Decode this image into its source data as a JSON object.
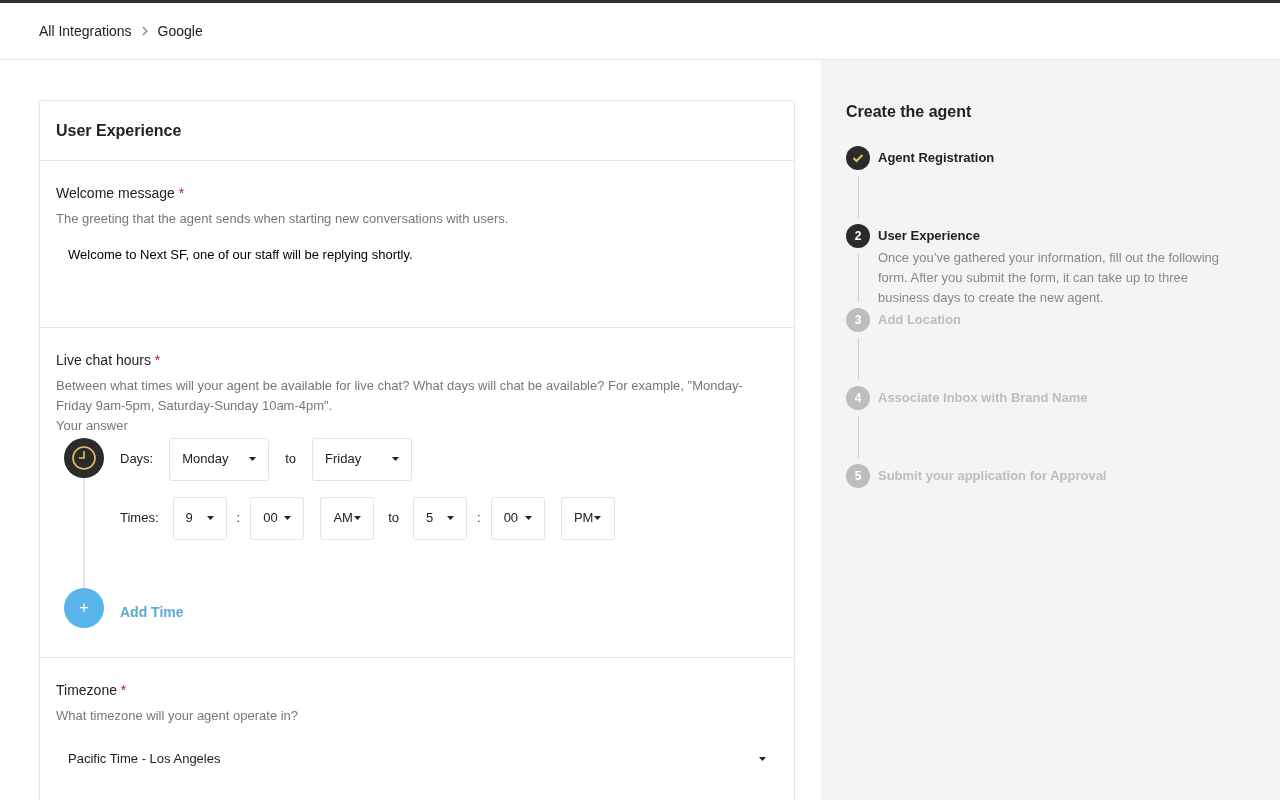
{
  "breadcrumb": [
    {
      "label": "All Integrations"
    },
    {
      "label": "Google"
    }
  ],
  "card": {
    "title": "User Experience",
    "welcome": {
      "label": "Welcome message",
      "required_mark": "*",
      "help": "The greeting that the agent sends when starting new conversations with users.",
      "value": "Welcome to Next SF, one of our staff will be replying shortly."
    },
    "hours": {
      "label": "Live chat hours",
      "required_mark": "*",
      "help": "Between what times will your agent be available for live chat? What days will chat be available? For example, \"Monday-Friday 9am-5pm, Saturday-Sunday 10am-4pm\".",
      "answer_label": "Your answer",
      "days_label": "Days:",
      "day_from": "Monday",
      "days_to": "to",
      "day_to": "Friday",
      "times_label": "Times:",
      "start": {
        "hour": "9",
        "sep": ":",
        "minute": "00",
        "period": "AM"
      },
      "times_to": "to",
      "end": {
        "hour": "5",
        "sep": ":",
        "minute": "00",
        "period": "PM"
      },
      "add_time": {
        "icon": "+",
        "label": "Add Time"
      }
    },
    "timezone": {
      "label": "Timezone",
      "required_mark": "*",
      "help": "What timezone will your agent operate in?",
      "value": "Pacific Time - Los Angeles"
    }
  },
  "steps_title": "Create the agent",
  "steps": [
    {
      "kind": "done",
      "title": "Agent Registration"
    },
    {
      "kind": "current",
      "number": "2",
      "title": "User Experience",
      "text": "Once you’ve gathered your information, fill out the following form. After you submit the form, it can take up to three business days to create the new agent."
    },
    {
      "kind": "pending",
      "number": "3",
      "title": "Add Location"
    },
    {
      "kind": "pending",
      "number": "4",
      "title": "Associate Inbox with Brand Name"
    },
    {
      "kind": "pending",
      "number": "5",
      "title": "Submit your application for Approval"
    }
  ]
}
